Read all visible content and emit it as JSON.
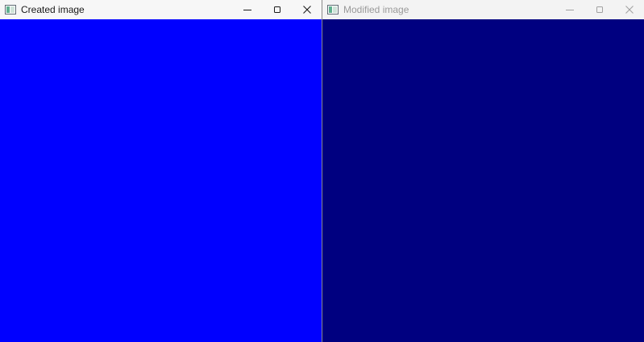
{
  "windows": [
    {
      "title": "Created image",
      "active": true,
      "fill_color": "#0000ff",
      "controls": [
        "minimize-icon",
        "maximize-icon",
        "close-icon"
      ]
    },
    {
      "title": "Modified image",
      "active": false,
      "fill_color": "#000080",
      "controls": [
        "minimize-icon",
        "maximize-icon",
        "close-icon"
      ]
    }
  ],
  "colors": {
    "app_icon_frame": "#5f6b73",
    "app_icon_fill": "#5fb08f"
  }
}
